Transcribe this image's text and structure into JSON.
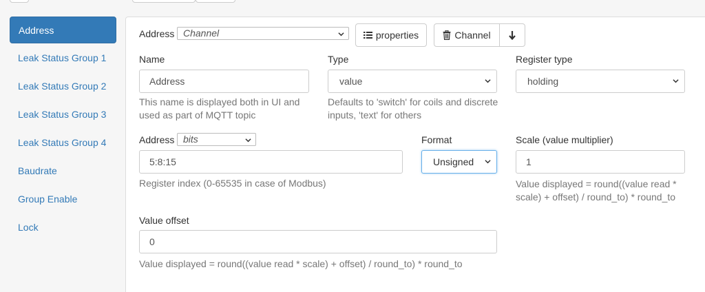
{
  "sidebar": {
    "items": [
      {
        "label": "Address"
      },
      {
        "label": "Leak Status Group 1"
      },
      {
        "label": "Leak Status Group 2"
      },
      {
        "label": "Leak Status Group 3"
      },
      {
        "label": "Leak Status Group 4"
      },
      {
        "label": "Baudrate"
      },
      {
        "label": "Group Enable"
      },
      {
        "label": "Lock"
      }
    ]
  },
  "header": {
    "address_label": "Address",
    "address_select": "Channel",
    "properties_button": "properties",
    "channel_button": "Channel"
  },
  "form": {
    "name": {
      "label": "Name",
      "value": "Address",
      "help": "This name is displayed both in UI and used as part of MQTT topic"
    },
    "type": {
      "label": "Type",
      "value": "value",
      "help": "Defaults to 'switch' for coils and discrete inputs, 'text' for others"
    },
    "register_type": {
      "label": "Register type",
      "value": "holding"
    },
    "address": {
      "label": "Address",
      "mode": "bits",
      "value": "5:8:15",
      "help": "Register index (0-65535 in case of Modbus)"
    },
    "format": {
      "label": "Format",
      "value": "Unsigned"
    },
    "scale": {
      "label": "Scale (value multiplier)",
      "value": "1",
      "help": "Value displayed = round((value read * scale) + offset) / round_to) * round_to"
    },
    "value_offset": {
      "label": "Value offset",
      "value": "0",
      "help": "Value displayed = round((value read * scale) + offset) / round_to) * round_to"
    }
  }
}
